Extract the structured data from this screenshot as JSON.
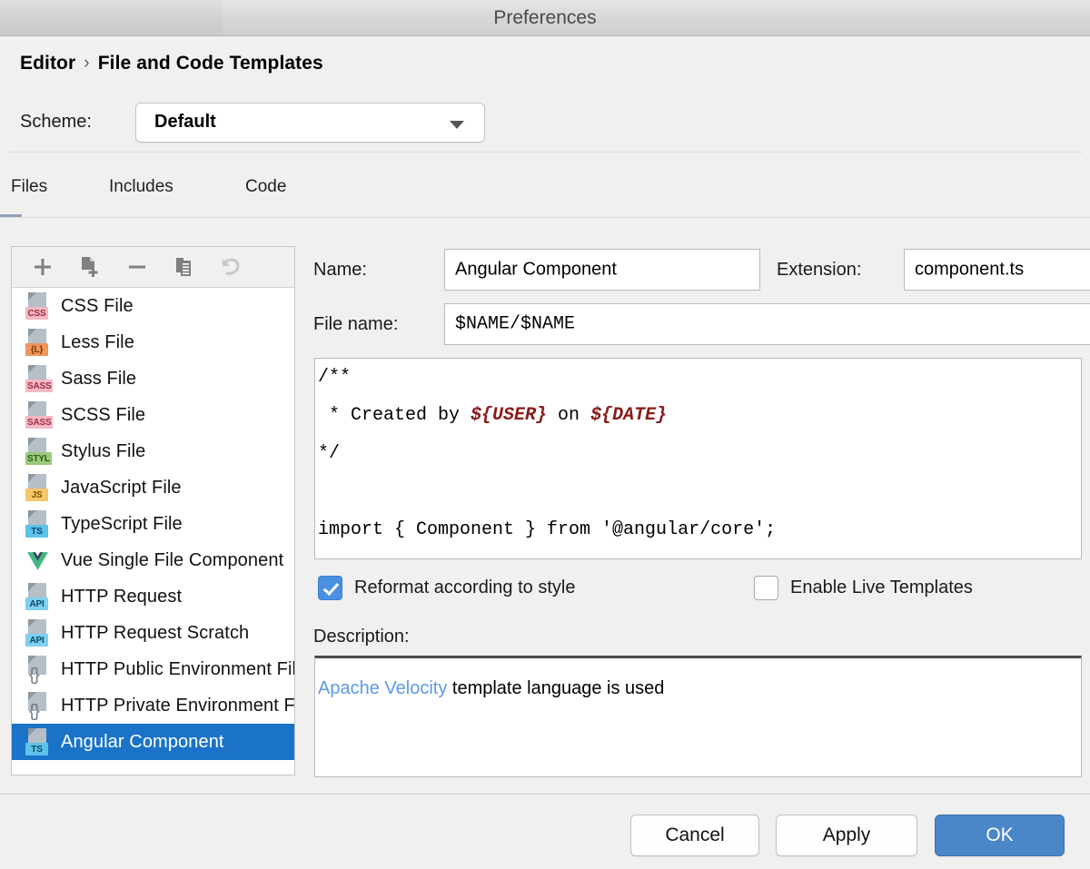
{
  "window": {
    "title": "Preferences"
  },
  "header": {
    "breadcrumb": {
      "root": "Editor",
      "separator": "›",
      "leaf": "File and Code Templates"
    },
    "scheme": {
      "label": "Scheme:",
      "value": "Default",
      "arrow_icon": "chevron-down-icon"
    }
  },
  "tabs": [
    {
      "label": "Files",
      "active": true
    },
    {
      "label": "Includes",
      "active": false
    },
    {
      "label": "Code",
      "active": false
    }
  ],
  "list_toolbar": [
    {
      "name": "add-button",
      "icon": "plus-icon",
      "enabled": true
    },
    {
      "name": "create-child-template-button",
      "icon": "file-add-icon",
      "enabled": true
    },
    {
      "name": "remove-button",
      "icon": "minus-icon",
      "enabled": true
    },
    {
      "name": "copy-button",
      "icon": "copy-icon",
      "enabled": true
    },
    {
      "name": "reset-button",
      "icon": "undo-arrow-icon",
      "enabled": false
    }
  ],
  "templates": [
    {
      "label": "CSS File",
      "icon": "css-file-icon",
      "badge": "CSS",
      "badge_bg": "#f5b8c4",
      "badge_fg": "#9c2d45",
      "selected": false
    },
    {
      "label": "Less File",
      "icon": "less-file-icon",
      "badge": "{L}",
      "badge_bg": "#f0955c",
      "badge_fg": "#7a3508",
      "selected": false
    },
    {
      "label": "Sass File",
      "icon": "sass-file-icon",
      "badge": "SASS",
      "badge_bg": "#f5b8c4",
      "badge_fg": "#9c2d45",
      "selected": false
    },
    {
      "label": "SCSS File",
      "icon": "scss-file-icon",
      "badge": "SASS",
      "badge_bg": "#f5b8c4",
      "badge_fg": "#9c2d45",
      "selected": false
    },
    {
      "label": "Stylus File",
      "icon": "stylus-file-icon",
      "badge": "STYL",
      "badge_bg": "#9bca7a",
      "badge_fg": "#2f5c18",
      "selected": false
    },
    {
      "label": "JavaScript File",
      "icon": "javascript-file-icon",
      "badge": "JS",
      "badge_bg": "#f5c66a",
      "badge_fg": "#7a5407",
      "selected": false
    },
    {
      "label": "TypeScript File",
      "icon": "typescript-file-icon",
      "badge": "TS",
      "badge_bg": "#5ec1ea",
      "badge_fg": "#0c4a66",
      "selected": false
    },
    {
      "label": "Vue Single File Component",
      "icon": "vue-logo-icon",
      "badge": "",
      "badge_bg": "",
      "badge_fg": "",
      "selected": false
    },
    {
      "label": "HTTP Request",
      "icon": "http-request-icon",
      "badge": "API",
      "badge_bg": "#7fd0ee",
      "badge_fg": "#0c4a66",
      "selected": false
    },
    {
      "label": "HTTP Request Scratch",
      "icon": "http-scratch-icon",
      "badge": "API",
      "badge_bg": "#7fd0ee",
      "badge_fg": "#0c4a66",
      "selected": false
    },
    {
      "label": "HTTP Public Environment File",
      "icon": "http-env-icon",
      "badge": "{}",
      "badge_bg": "",
      "badge_fg": "",
      "selected": false
    },
    {
      "label": "HTTP Private Environment File",
      "icon": "http-env-icon",
      "badge": "{}",
      "badge_bg": "",
      "badge_fg": "",
      "selected": false
    },
    {
      "label": "Angular Component",
      "icon": "angular-component-icon",
      "badge": "TS",
      "badge_bg": "#5ec1ea",
      "badge_fg": "#0c4a66",
      "selected": true
    }
  ],
  "details": {
    "name_label": "Name:",
    "name_value": "Angular Component",
    "extension_label": "Extension:",
    "extension_value": "component.ts",
    "filename_label": "File name:",
    "filename_value": "$NAME/$NAME",
    "code": {
      "line1": "/**",
      "line2_prefix": " * Created by ",
      "line2_var1": "${USER}",
      "line2_mid": " on ",
      "line2_var2": "${DATE}",
      "line3": "*/",
      "line4": "",
      "line5": "import { Component } from '@angular/core';"
    },
    "checkbox_reformat": {
      "label": "Reformat according to style",
      "checked": true
    },
    "checkbox_live_templates": {
      "label": "Enable Live Templates",
      "checked": false
    },
    "description_label": "Description:",
    "description_link": "Apache Velocity",
    "description_rest": " template language is used"
  },
  "footer": {
    "cancel": "Cancel",
    "apply": "Apply",
    "ok": "OK"
  },
  "colors": {
    "selection_blue": "#1a73c8",
    "primary_button": "#4a86c8",
    "checkbox_blue": "#4a90e2",
    "link_blue": "#5a9ae8",
    "template_var_red": "#8b1a1a",
    "tab_underline": "#92a3b8"
  }
}
